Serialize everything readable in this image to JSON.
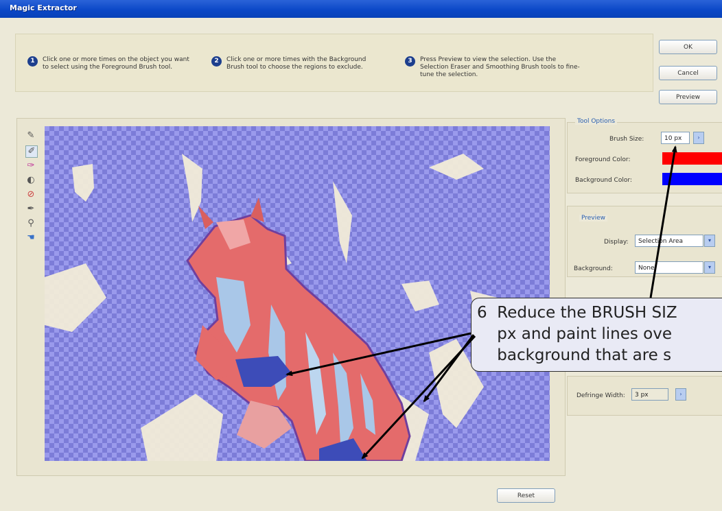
{
  "window": {
    "title": "Magic Extractor"
  },
  "steps": [
    {
      "num": "1",
      "text": "Click one or more times on the object you want to select using the Foreground Brush tool."
    },
    {
      "num": "2",
      "text": "Click one or more times with the Background Brush tool to choose the regions to exclude."
    },
    {
      "num": "3",
      "text": "Press Preview to view the selection. Use the Selection Eraser and Smoothing Brush tools to fine-tune the selection."
    }
  ],
  "buttons": {
    "ok": "OK",
    "cancel": "Cancel",
    "preview": "Preview",
    "reset": "Reset"
  },
  "tool_options": {
    "title": "Tool Options",
    "brush_size_label": "Brush Size:",
    "brush_size_value": "10 px",
    "foreground_color_label": "Foreground Color:",
    "foreground_color": "#ff0000",
    "background_color_label": "Background Color:",
    "background_color": "#0000ff"
  },
  "preview_group": {
    "title": "Preview",
    "display_label": "Display:",
    "display_value": "Selection Area",
    "background_label": "Background:",
    "background_value": "None"
  },
  "defringe": {
    "label": "Defringe Width:",
    "value": "3 px"
  },
  "tools": [
    "foreground-brush-icon",
    "background-brush-icon",
    "selection-eraser-icon",
    "add-selection-icon",
    "remove-selection-icon",
    "smoothing-brush-icon",
    "zoom-icon",
    "hand-icon"
  ],
  "callout": {
    "line1": "6  Reduce the BRUSH SIZ",
    "line2": "    px and paint lines ove",
    "line3": "    background that are s"
  }
}
